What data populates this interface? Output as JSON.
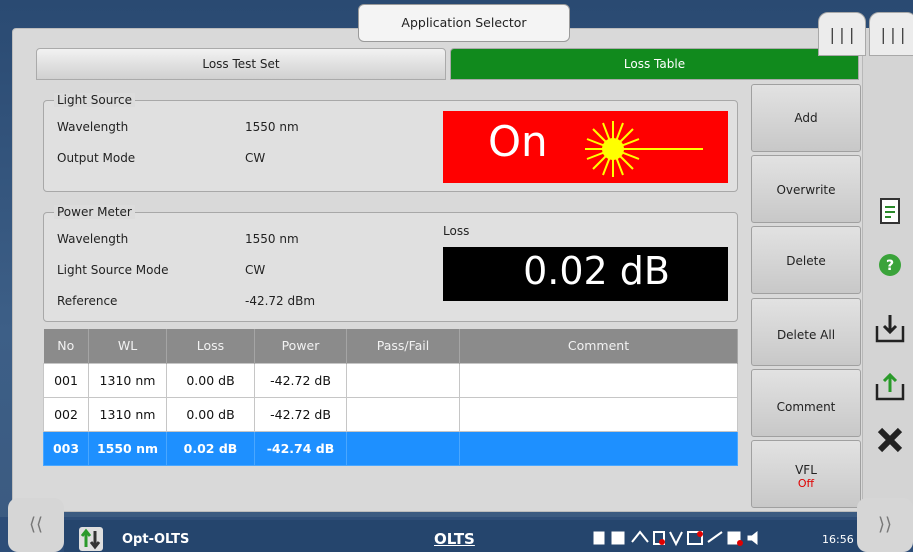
{
  "app_selector": {
    "label": "Application Selector"
  },
  "handles": {
    "left": "|||",
    "right": "|||"
  },
  "tabs": {
    "test_set": "Loss Test Set",
    "table": "Loss Table"
  },
  "light_source": {
    "legend": "Light Source",
    "wavelength_label": "Wavelength",
    "wavelength_value": "1550 nm",
    "output_mode_label": "Output Mode",
    "output_mode_value": "CW",
    "status": "On"
  },
  "power_meter": {
    "legend": "Power Meter",
    "wavelength_label": "Wavelength",
    "wavelength_value": "1550 nm",
    "ls_mode_label": "Light Source Mode",
    "ls_mode_value": "CW",
    "reference_label": "Reference",
    "reference_value": "-42.72 dBm",
    "loss_label": "Loss",
    "loss_value": "0.02 dB"
  },
  "table": {
    "headers": [
      "No",
      "WL",
      "Loss",
      "Power",
      "Pass/Fail",
      "Comment"
    ],
    "rows": [
      [
        "001",
        "1310 nm",
        "0.00 dB",
        "-42.72 dB",
        "",
        ""
      ],
      [
        "002",
        "1310 nm",
        "0.00 dB",
        "-42.72 dB",
        "",
        ""
      ],
      [
        "003",
        "1550 nm",
        "0.02 dB",
        "-42.74 dB",
        "",
        ""
      ]
    ],
    "selected_row": 2
  },
  "buttons": {
    "add": "Add",
    "overwrite": "Overwrite",
    "delete": "Delete",
    "delete_all": "Delete All",
    "comment": "Comment",
    "vfl": "VFL",
    "vfl_state": "Off"
  },
  "taskbar": {
    "app_name": "Opt-OLTS",
    "mode": "OLTS",
    "time": "16:56"
  },
  "colors": {
    "on_box": "#ff0000",
    "loss_table_tab": "#118a1d",
    "selected_row": "#1e90ff",
    "vfl_off": "#e00000"
  },
  "icons": [
    "report-icon",
    "help-icon",
    "save-icon",
    "load-icon",
    "close-icon",
    "sort-icon"
  ]
}
